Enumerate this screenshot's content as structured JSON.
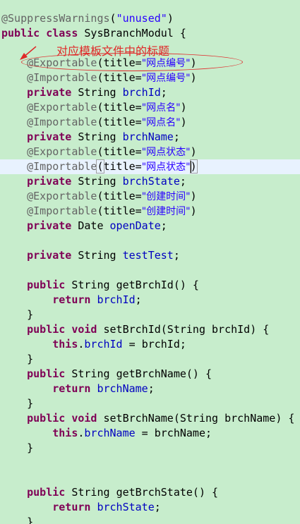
{
  "editor": {
    "keywords": {
      "public": "public",
      "class": "class",
      "private": "private",
      "void": "void",
      "return": "return",
      "this": "this"
    },
    "suppress_annotation": "@SuppressWarnings",
    "suppress_value": "\"unused\"",
    "class_name": "SysBranchModul {",
    "fields": [
      {
        "exp_title": "\"网点编号\"",
        "imp_title": "\"网点编号\"",
        "type": "String",
        "name": "brchId"
      },
      {
        "exp_title": "\"网点名\"",
        "imp_title": "\"网点名\"",
        "type": "String",
        "name": "brchName"
      },
      {
        "exp_title": "\"网点状态\"",
        "imp_title": "\"网点状态\"",
        "type": "String",
        "name": "brchState"
      },
      {
        "exp_title": "\"创建时间\"",
        "imp_title": "\"创建时间\"",
        "type": "Date",
        "name": "openDate"
      }
    ],
    "extra_field": {
      "type": "String",
      "name": "testTest"
    },
    "exportable": "@Exportable",
    "importable": "@Importable",
    "title_key": "title=",
    "methods": {
      "get_brch_id": "getBrchId() {",
      "set_brch_id": "setBrchId(String ",
      "get_brch_name": "getBrchName() {",
      "set_brch_name": "setBrchName(String ",
      "get_brch_state": "getBrchState() {"
    },
    "param_brch_id": "brchId",
    "param_brch_name": "brchName"
  },
  "annotation_note": {
    "text": "对应模板文件中的标题",
    "color": "#e02828"
  }
}
